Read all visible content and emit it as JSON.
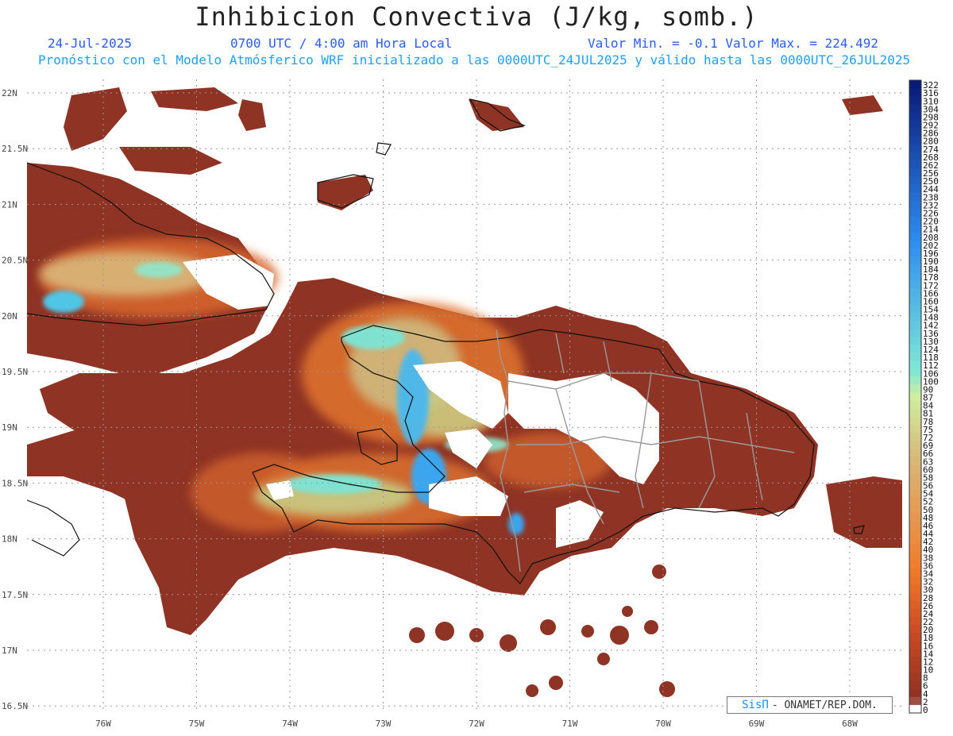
{
  "header": {
    "title": "Inhibicion Convectiva (J/kg, somb.)",
    "date": "24-Jul-2025",
    "time": "0700 UTC / 4:00 am Hora Local",
    "minmax": "Valor Min. = -0.1  Valor Max. = 224.492",
    "model_line": "Pronóstico con el Modelo Atmósferico WRF inicializado a las 0000UTC_24JUL2025 y válido hasta las  0000UTC_26JUL2025"
  },
  "map": {
    "lat_labels": [
      "22N",
      "21.5N",
      "21N",
      "20.5N",
      "20N",
      "19.5N",
      "19N",
      "18.5N",
      "18N",
      "17.5N",
      "17N",
      "16.5N"
    ],
    "lon_labels": [
      "76W",
      "75W",
      "74W",
      "73W",
      "72W",
      "71W",
      "70W",
      "69W",
      "68W"
    ],
    "grid": true,
    "land_color": "#ffffff",
    "coast_color": "#111111",
    "border_color": "#9a9a9a"
  },
  "colorbar": {
    "labels": [
      "322",
      "316",
      "310",
      "304",
      "298",
      "292",
      "286",
      "280",
      "274",
      "268",
      "262",
      "256",
      "250",
      "244",
      "238",
      "232",
      "226",
      "220",
      "214",
      "208",
      "202",
      "196",
      "190",
      "184",
      "178",
      "172",
      "166",
      "160",
      "154",
      "148",
      "142",
      "136",
      "130",
      "124",
      "118",
      "112",
      "106",
      "100",
      "90",
      "87",
      "84",
      "81",
      "78",
      "75",
      "72",
      "69",
      "66",
      "63",
      "60",
      "58",
      "56",
      "54",
      "52",
      "50",
      "48",
      "46",
      "44",
      "42",
      "40",
      "38",
      "36",
      "34",
      "32",
      "30",
      "28",
      "26",
      "24",
      "22",
      "20",
      "18",
      "16",
      "14",
      "12",
      "10",
      "8",
      "6",
      "4",
      "2",
      "0"
    ],
    "colors": {
      "high": "#0a1a7a",
      "mid_blue": "#2f8cf0",
      "cyan": "#7fe8d6",
      "green": "#cfeea0",
      "tan": "#d8b87a",
      "orange": "#f07a2a",
      "red": "#c84a24",
      "dark": "#8e3022",
      "zero": "#ffffff"
    }
  },
  "credit": {
    "brand": "SisΠ",
    "org": "- ONAMET/REP.DOM."
  }
}
